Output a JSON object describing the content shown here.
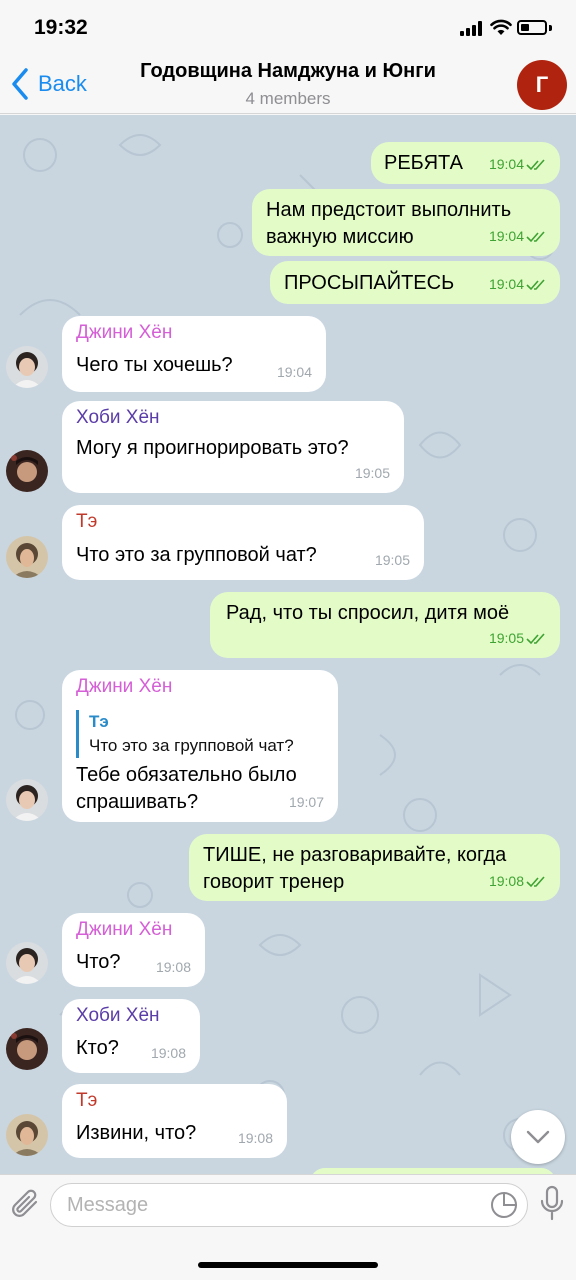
{
  "status_bar": {
    "time": "19:32",
    "battery_level": 0.35
  },
  "header": {
    "back_label": "Back",
    "title": "Годовщина Намджуна и Юнги",
    "subtitle": "4 members",
    "avatar_letter": "Г",
    "avatar_color": "#b0240f"
  },
  "colors": {
    "outgoing_bubble": "#e3fcc7",
    "incoming_bubble": "#ffffff",
    "time_outgoing": "#3fa333",
    "accent": "#1a8cf0",
    "sender_jin": "#d55fd6",
    "sender_hobi": "#5b3da8",
    "sender_tae": "#c0392b"
  },
  "messages": [
    {
      "dir": "out",
      "text": "РЕБЯТА",
      "time": "19:04"
    },
    {
      "dir": "out",
      "text": "Нам предстоит выполнить\nважную миссию",
      "time": "19:04"
    },
    {
      "dir": "out",
      "text": "ПРОСЫПАЙТЕСЬ",
      "time": "19:04"
    },
    {
      "dir": "in",
      "sender": "Джини Хён",
      "text": "Чего ты хочешь?",
      "time": "19:04"
    },
    {
      "dir": "in",
      "sender": "Хоби Хён",
      "text": "Могу я проигнорировать это?",
      "time": "19:05"
    },
    {
      "dir": "in",
      "sender": "Тэ",
      "text": "Что это за групповой чат?",
      "time": "19:05"
    },
    {
      "dir": "out",
      "text": "Рад, что ты спросил, дитя моё",
      "time": "19:05"
    },
    {
      "dir": "in",
      "sender": "Джини Хён",
      "reply_name": "Тэ",
      "reply_text": "Что это за групповой чат?",
      "text": "Тебе обязательно было\nспрашивать?",
      "time": "19:07"
    },
    {
      "dir": "out",
      "text": "ТИШЕ, не разговаривайте, когда\nговорит тренер",
      "time": "19:08"
    },
    {
      "dir": "in",
      "sender": "Джини Хён",
      "text": "Что?",
      "time": "19:08"
    },
    {
      "dir": "in",
      "sender": "Хоби Хён",
      "text": "Кто?",
      "time": "19:08"
    },
    {
      "dir": "in",
      "sender": "Тэ",
      "text": "Извини, что?",
      "time": "19:08"
    }
  ],
  "input": {
    "placeholder": "Message",
    "value": ""
  },
  "icons": [
    "back-chevron-icon",
    "paperclip-icon",
    "sticker-icon",
    "microphone-icon",
    "chevron-down-icon",
    "double-check-icon"
  ]
}
